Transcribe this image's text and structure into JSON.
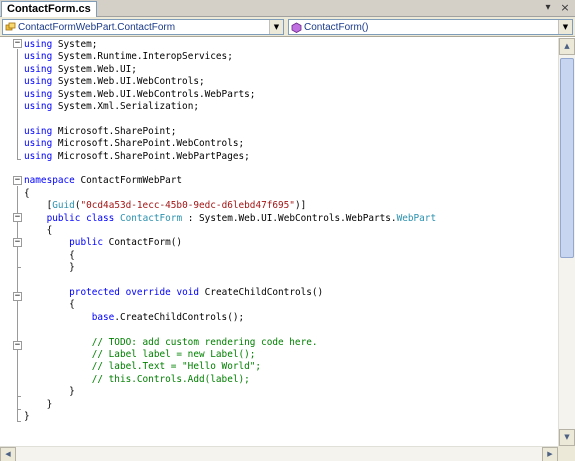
{
  "window": {
    "tab_title": "ContactForm.cs",
    "dropdown_glyph": "▾",
    "close_glyph": "×"
  },
  "navbar": {
    "type_combo": {
      "value": "ContactFormWebPart.ContactForm",
      "icon": "class-icon"
    },
    "member_combo": {
      "value": "ContactForm()",
      "icon": "method-icon"
    }
  },
  "colors": {
    "keyword": "#0000ff",
    "type": "#2b91af",
    "string": "#a31515",
    "comment": "#008000"
  },
  "code": [
    [
      {
        "t": "using",
        "c": "kw"
      },
      {
        "t": " System;"
      }
    ],
    [
      {
        "t": "using",
        "c": "kw"
      },
      {
        "t": " System.Runtime.InteropServices;"
      }
    ],
    [
      {
        "t": "using",
        "c": "kw"
      },
      {
        "t": " System.Web.UI;"
      }
    ],
    [
      {
        "t": "using",
        "c": "kw"
      },
      {
        "t": " System.Web.UI.WebControls;"
      }
    ],
    [
      {
        "t": "using",
        "c": "kw"
      },
      {
        "t": " System.Web.UI.WebControls.WebParts;"
      }
    ],
    [
      {
        "t": "using",
        "c": "kw"
      },
      {
        "t": " System.Xml.Serialization;"
      }
    ],
    [],
    [
      {
        "t": "using",
        "c": "kw"
      },
      {
        "t": " Microsoft.SharePoint;"
      }
    ],
    [
      {
        "t": "using",
        "c": "kw"
      },
      {
        "t": " Microsoft.SharePoint.WebControls;"
      }
    ],
    [
      {
        "t": "using",
        "c": "kw"
      },
      {
        "t": " Microsoft.SharePoint.WebPartPages;"
      }
    ],
    [],
    [
      {
        "t": "namespace",
        "c": "kw"
      },
      {
        "t": " ContactFormWebPart"
      }
    ],
    [
      {
        "t": "{"
      }
    ],
    [
      {
        "t": "    ["
      },
      {
        "t": "Guid",
        "c": "ty"
      },
      {
        "t": "("
      },
      {
        "t": "\"0cd4a53d-1ecc-45b0-9edc-d6lebd47f695\"",
        "c": "str"
      },
      {
        "t": ")]"
      }
    ],
    [
      {
        "t": "    "
      },
      {
        "t": "public",
        "c": "kw"
      },
      {
        "t": " "
      },
      {
        "t": "class",
        "c": "kw"
      },
      {
        "t": " "
      },
      {
        "t": "ContactForm",
        "c": "ty"
      },
      {
        "t": " : System.Web.UI.WebControls.WebParts."
      },
      {
        "t": "WebPart",
        "c": "ty"
      }
    ],
    [
      {
        "t": "    {"
      }
    ],
    [
      {
        "t": "        "
      },
      {
        "t": "public",
        "c": "kw"
      },
      {
        "t": " ContactForm()"
      }
    ],
    [
      {
        "t": "        {"
      }
    ],
    [
      {
        "t": "        }"
      }
    ],
    [],
    [
      {
        "t": "        "
      },
      {
        "t": "protected",
        "c": "kw"
      },
      {
        "t": " "
      },
      {
        "t": "override",
        "c": "kw"
      },
      {
        "t": " "
      },
      {
        "t": "void",
        "c": "kw"
      },
      {
        "t": " CreateChildControls()"
      }
    ],
    [
      {
        "t": "        {"
      }
    ],
    [
      {
        "t": "            "
      },
      {
        "t": "base",
        "c": "kw"
      },
      {
        "t": ".CreateChildControls();"
      }
    ],
    [],
    [
      {
        "t": "            "
      },
      {
        "t": "// TODO: add custom rendering code here.",
        "c": "cm"
      }
    ],
    [
      {
        "t": "            "
      },
      {
        "t": "// Label label = new Label();",
        "c": "cm"
      }
    ],
    [
      {
        "t": "            "
      },
      {
        "t": "// label.Text = \"Hello World\";",
        "c": "cm"
      }
    ],
    [
      {
        "t": "            "
      },
      {
        "t": "// this.Controls.Add(label);",
        "c": "cm"
      }
    ],
    [
      {
        "t": "        }"
      }
    ],
    [
      {
        "t": "    }"
      }
    ],
    [
      {
        "t": "}"
      }
    ]
  ]
}
